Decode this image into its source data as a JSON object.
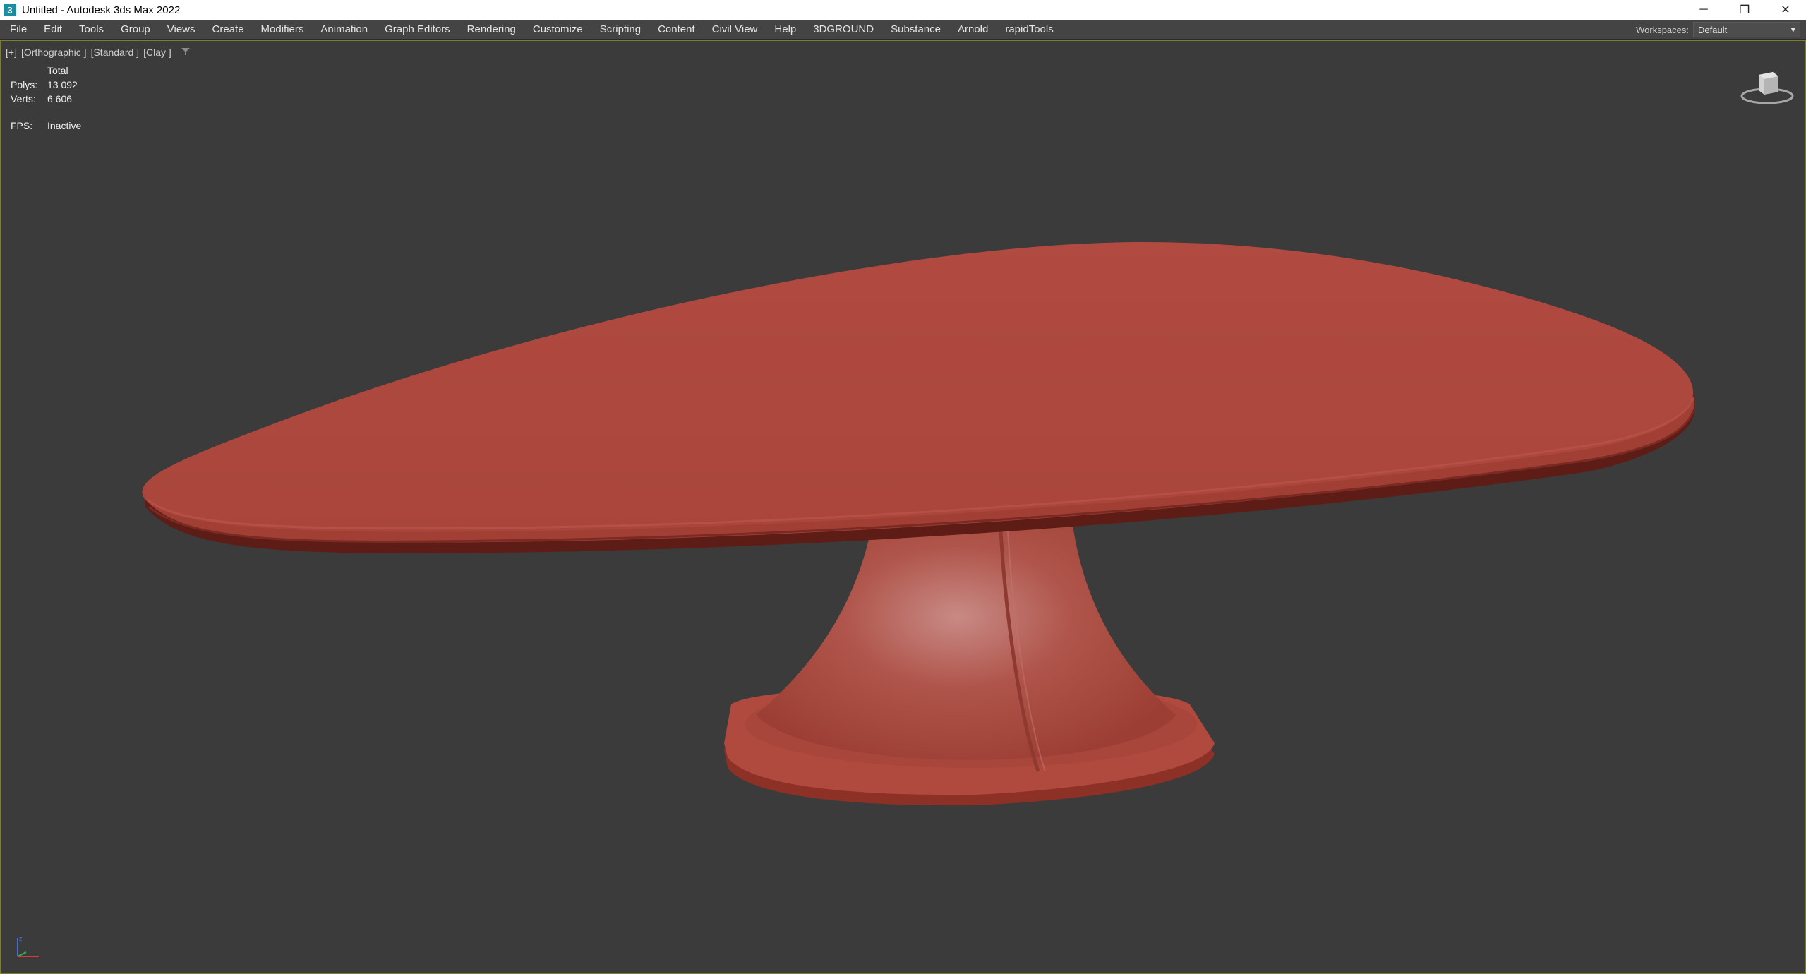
{
  "window": {
    "app_icon_letter": "3",
    "title": "Untitled - Autodesk 3ds Max 2022",
    "controls": {
      "minimize": "─",
      "restore": "❐",
      "close": "✕"
    }
  },
  "menubar": {
    "items": [
      "File",
      "Edit",
      "Tools",
      "Group",
      "Views",
      "Create",
      "Modifiers",
      "Animation",
      "Graph Editors",
      "Rendering",
      "Customize",
      "Scripting",
      "Content",
      "Civil View",
      "Help",
      "3DGROUND",
      "Substance",
      "Arnold",
      "rapidTools"
    ],
    "workspaces_label": "Workspaces:",
    "workspaces_value": "Default",
    "workspaces_arrow": "▾"
  },
  "viewport": {
    "label_parts": [
      "[+]",
      "[Orthographic ]",
      "[Standard ]",
      "[Clay ]"
    ],
    "filter_icon": "filter-icon",
    "stats": {
      "header": "Total",
      "polys_label": "Polys:",
      "polys_value": "13 092",
      "verts_label": "Verts:",
      "verts_value": "6 606",
      "fps_label": "FPS:",
      "fps_value": "Inactive"
    },
    "viewcube_icon": "viewcube-icon",
    "axis_icon": "axis-tripod-icon",
    "model_color": "#b04a3f"
  }
}
